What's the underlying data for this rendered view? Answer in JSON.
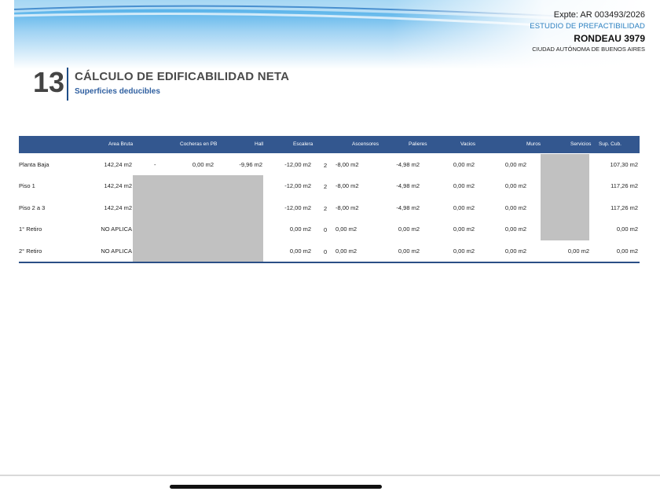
{
  "header": {
    "expte": "Expte: AR 003493/2026",
    "estudio": "ESTUDIO DE PREFACTIBILIDAD",
    "rondeau": "RONDEAU 3979",
    "ciudad": "CIUDAD AUTÓNOMA DE BUENOS AIRES"
  },
  "section": {
    "number": "13",
    "title": "CÁLCULO DE EDIFICABILIDAD NETA",
    "subtitle": "Superficies deducibles"
  },
  "table": {
    "columns": {
      "area_bruta": "Area Bruta",
      "cocheras": "Cocheras en PB",
      "hall": "Hall",
      "escalera": "Escalera",
      "ascensores": "Ascensores",
      "palieres": "Palieres",
      "vacios": "Vacios",
      "muros": "Muros",
      "servicios": "Servicios",
      "vendible": "Sup. Cub. Vendible"
    },
    "rows": [
      {
        "label": "Planta Baja",
        "area_bruta": "142,24 m2",
        "coch_dash": "-",
        "cocheras": "0,00 m2",
        "hall": "-9,96 m2",
        "escalera": "-12,00 m2",
        "asc_count": "2",
        "ascensores": "-8,00 m2",
        "palieres": "-4,98 m2",
        "vacios": "0,00 m2",
        "muros": "0,00 m2",
        "servicios": "",
        "vendible": "107,30 m2"
      },
      {
        "label": "Piso 1",
        "area_bruta": "142,24 m2",
        "coch_dash": "",
        "cocheras": "",
        "hall": "",
        "escalera": "-12,00 m2",
        "asc_count": "2",
        "ascensores": "-8,00 m2",
        "palieres": "-4,98 m2",
        "vacios": "0,00 m2",
        "muros": "0,00 m2",
        "servicios": "",
        "vendible": "117,26 m2"
      },
      {
        "label": "Piso 2 a 3",
        "area_bruta": "142,24 m2",
        "coch_dash": "",
        "cocheras": "",
        "hall": "",
        "escalera": "-12,00 m2",
        "asc_count": "2",
        "ascensores": "-8,00 m2",
        "palieres": "-4,98 m2",
        "vacios": "0,00 m2",
        "muros": "0,00 m2",
        "servicios": "",
        "vendible": "117,26 m2"
      },
      {
        "label": "1° Retiro",
        "area_bruta": "NO APLICA",
        "coch_dash": "",
        "cocheras": "",
        "hall": "",
        "escalera": "0,00 m2",
        "asc_count": "0",
        "ascensores": "0,00 m2",
        "palieres": "0,00 m2",
        "vacios": "0,00 m2",
        "muros": "0,00 m2",
        "servicios": "",
        "vendible": "0,00 m2"
      },
      {
        "label": "2° Retiro",
        "area_bruta": "NO APLICA",
        "coch_dash": "",
        "cocheras": "",
        "hall": "",
        "escalera": "0,00 m2",
        "asc_count": "0",
        "ascensores": "0,00 m2",
        "palieres": "0,00 m2",
        "vacios": "0,00 m2",
        "muros": "0,00 m2",
        "servicios": "0,00 m2",
        "vendible": "0,00 m2"
      }
    ]
  },
  "colors": {
    "header_blue": "#33578f",
    "accent_blue": "#2a7fc0",
    "disabled_gray": "#c1c1c1"
  }
}
